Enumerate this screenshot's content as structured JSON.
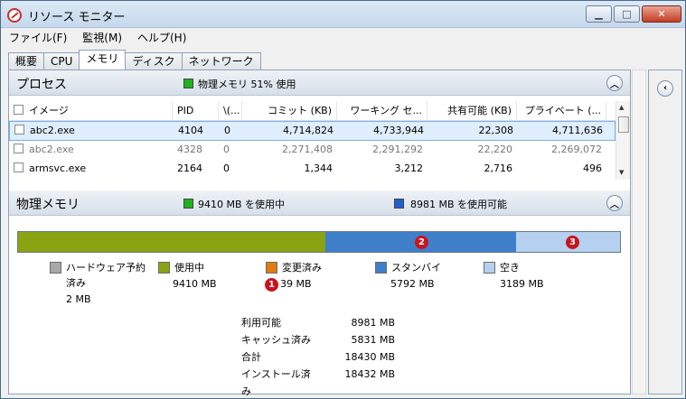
{
  "window": {
    "title": "リソース モニター",
    "close_glyph": "✕",
    "max_glyph": "□",
    "min_glyph": "▁"
  },
  "menu": [
    "ファイル(F)",
    "監視(M)",
    "ヘルプ(H)"
  ],
  "tabs": [
    "概要",
    "CPU",
    "メモリ",
    "ディスク",
    "ネットワーク"
  ],
  "active_tab": 2,
  "process": {
    "title": "プロセス",
    "indicator_text": "物理メモリ 51% 使用",
    "indicator_color": "#1bb41b",
    "columns": [
      "イメージ",
      "PID",
      "\\(...",
      "コミット (KB)",
      "ワーキング セ...",
      "共有可能 (KB)",
      "プライベート (..."
    ],
    "rows": [
      {
        "image": "abc2.exe",
        "pid": "4104",
        "hard": "0",
        "commit": "4,714,824",
        "working": "4,733,944",
        "shareable": "22,308",
        "private": "4,711,636"
      },
      {
        "image": "abc2.exe",
        "pid": "4328",
        "hard": "0",
        "commit": "2,271,408",
        "working": "2,291,292",
        "shareable": "22,220",
        "private": "2,269,072"
      },
      {
        "image": "armsvc.exe",
        "pid": "2164",
        "hard": "0",
        "commit": "1,344",
        "working": "3,212",
        "shareable": "2,716",
        "private": "496"
      }
    ]
  },
  "physical": {
    "title": "物理メモリ",
    "inuse_text": "9410 MB を使用中",
    "available_text": "8981 MB を使用可能",
    "inuse_color": "#1bb41b",
    "available_color": "#1f5fcf",
    "bar": {
      "in_use_mb": 9410,
      "modified_mb": 39,
      "standby_mb": 5792,
      "free_mb": 3189
    },
    "legend": [
      {
        "label": "ハードウェア予約",
        "label2": "済み",
        "value": "2 MB",
        "color": "#a8a8a8"
      },
      {
        "label": "使用中",
        "value": "9410 MB",
        "color": "#89a313"
      },
      {
        "label": "変更済み",
        "value": "39 MB",
        "color": "#e07d10"
      },
      {
        "label": "スタンバイ",
        "value": "5792 MB",
        "color": "#3f7fc9"
      },
      {
        "label": "空き",
        "value": "3189 MB",
        "color": "#b5d1ef"
      }
    ],
    "badges": [
      "1",
      "2",
      "3"
    ],
    "summary": [
      {
        "k": "利用可能",
        "v": "8981 MB"
      },
      {
        "k": "キャッシュ済み",
        "v": "5831 MB"
      },
      {
        "k": "合計",
        "v": "18430 MB"
      },
      {
        "k": "インストール済み",
        "v": "18432 MB"
      }
    ]
  },
  "icons": {
    "collapse": "chevron-up-icon",
    "expand": "chevron-left-icon"
  }
}
